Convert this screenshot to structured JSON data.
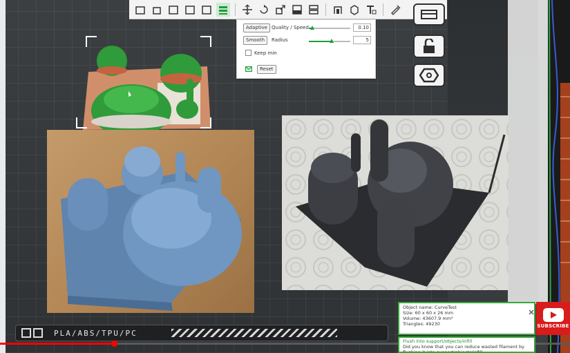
{
  "popup": {
    "adaptive_label": "Adaptive",
    "quality_label": "Quality / Speed",
    "quality_value": "0.10",
    "quality_level": 0.08,
    "smooth_label": "Smooth",
    "radius_label": "Radius",
    "radius_value": "5",
    "radius_level": 0.55,
    "keep_min_label": "Keep min",
    "reset_label": "Reset"
  },
  "bottombar": {
    "filament_label": "PLA/ABS/TPU/PC"
  },
  "video": {
    "progress": 0.2
  },
  "info": {
    "name": "Object name: CurveTest",
    "size": "Size: 60 x 60 x 26 mm",
    "volume": "Volume: 43607.9 mm³",
    "triangles": "Triangles: 49230"
  },
  "hint": {
    "link": "Flush into support/objects/infill",
    "text": "Did you know that you can reduce wasted filament by flushing it into support/objects/infill"
  },
  "youtube": {
    "subscribe_label": "SUBSCRIBE"
  },
  "colors": {
    "accent_green": "#1f9c3a",
    "youtube_red": "#d81b1b"
  }
}
